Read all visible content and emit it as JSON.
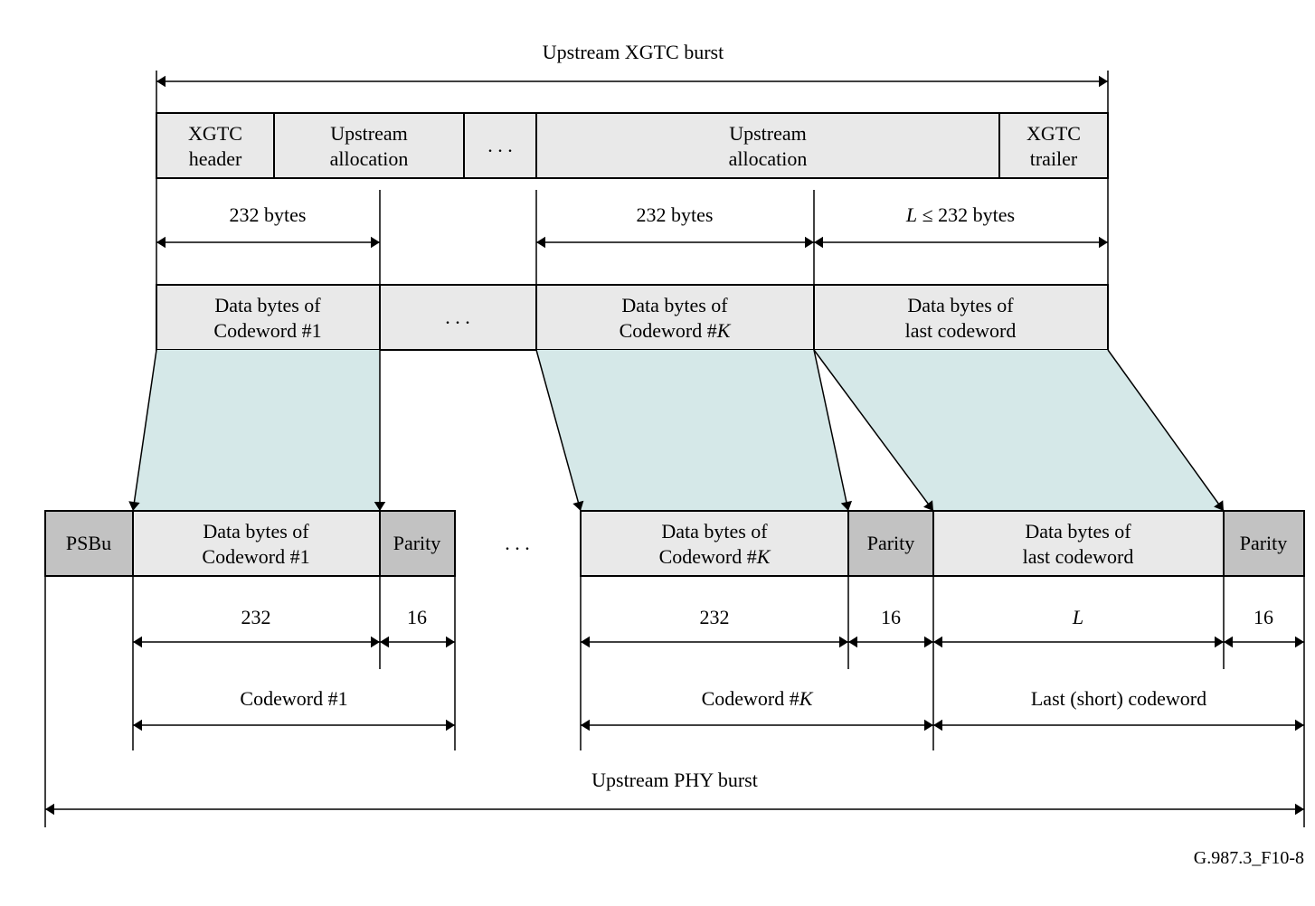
{
  "title_top": "Upstream XGTC burst",
  "xgtc": {
    "header1": "XGTC",
    "header2": "header",
    "alloc1": "Upstream",
    "alloc2": "allocation",
    "dots": ". . .",
    "allocb1": "Upstream",
    "allocb2": "allocation",
    "trailer1": "XGTC",
    "trailer2": "trailer"
  },
  "mid_labels": {
    "b1": "232 bytes",
    "bk": "232 bytes",
    "last_prefix": "L",
    "last_rest": " ≤ 232 bytes"
  },
  "data_row": {
    "d1a": "Data bytes of",
    "d1b": "Codeword #1",
    "dots": ". . .",
    "dka": "Data bytes of",
    "dkb_prefix": "Codeword #",
    "dkb_k": "K",
    "dla": "Data bytes of",
    "dlb": "last codeword"
  },
  "phy": {
    "psbu": "PSBu",
    "d1a": "Data bytes of",
    "d1b": "Codeword #1",
    "parity": "Parity",
    "dots": ". . .",
    "dka": "Data bytes of",
    "dkb_prefix": "Codeword #",
    "dkb_k": "K",
    "dla": "Data bytes of",
    "dlb": "last codeword"
  },
  "bottom_nums": {
    "n1": "232",
    "p1": "16",
    "nk": "232",
    "pk": "16",
    "nl": "L",
    "pl": "16"
  },
  "cw_labels": {
    "c1": "Codeword #1",
    "ck_prefix": "Codeword #",
    "ck_k": "K",
    "last": "Last (short) codeword"
  },
  "title_bottom": "Upstream PHY burst",
  "figure_ref": "G.987.3_F10-8"
}
